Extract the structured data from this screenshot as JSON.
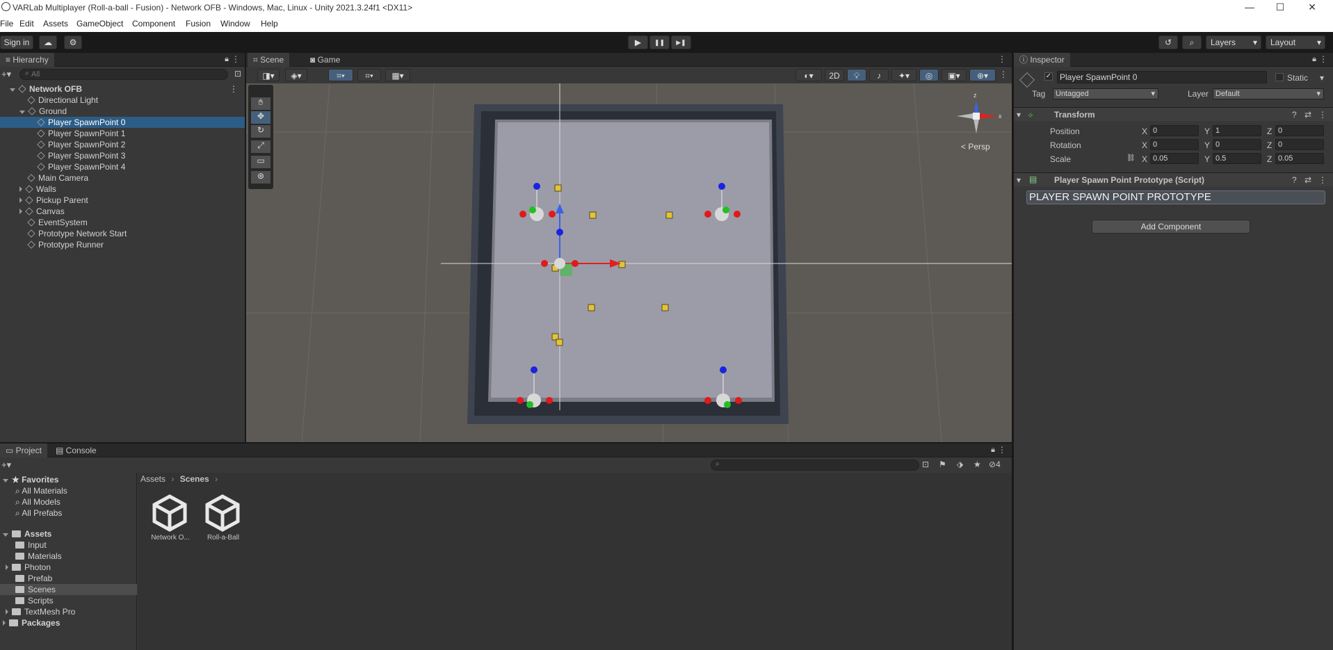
{
  "window": {
    "title": "VARLab Multiplayer (Roll-a-ball - Fusion) - Network OFB - Windows, Mac, Linux - Unity 2021.3.24f1 <DX11>",
    "minimize": "—",
    "maximize": "☐",
    "close": "✕"
  },
  "menu": [
    "File",
    "Edit",
    "Assets",
    "GameObject",
    "Component",
    "Fusion",
    "Window",
    "Help"
  ],
  "toolbar": {
    "sign_in": "Sign in",
    "cloud_icon": "cloud-icon",
    "play": "▶",
    "pause": "❚❚",
    "step": "▶❚",
    "layers": "Layers",
    "layout": "Layout"
  },
  "hierarchy": {
    "tab": "Hierarchy",
    "search_placeholder": "All",
    "items": [
      {
        "label": "Network OFB",
        "depth": 0,
        "bold": true
      },
      {
        "label": "Directional Light",
        "depth": 1
      },
      {
        "label": "Ground",
        "depth": 1
      },
      {
        "label": "Player SpawnPoint 0",
        "depth": 2,
        "selected": true
      },
      {
        "label": "Player SpawnPoint 1",
        "depth": 2
      },
      {
        "label": "Player SpawnPoint 2",
        "depth": 2
      },
      {
        "label": "Player SpawnPoint 3",
        "depth": 2
      },
      {
        "label": "Player SpawnPoint 4",
        "depth": 2
      },
      {
        "label": "Main Camera",
        "depth": 1
      },
      {
        "label": "Walls",
        "depth": 1
      },
      {
        "label": "Pickup Parent",
        "depth": 1
      },
      {
        "label": "Canvas",
        "depth": 1
      },
      {
        "label": "EventSystem",
        "depth": 1
      },
      {
        "label": "Prototype Network Start",
        "depth": 1
      },
      {
        "label": "Prototype Runner",
        "depth": 1
      }
    ]
  },
  "scene": {
    "tabs": [
      "Scene",
      "Game"
    ],
    "mode_2d": "2D",
    "persp_label": "< Persp",
    "axis_x": "x",
    "axis_z": "z"
  },
  "inspector": {
    "tab": "Inspector",
    "object_name": "Player SpawnPoint 0",
    "static_label": "Static",
    "tag_label": "Tag",
    "tag_value": "Untagged",
    "layer_label": "Layer",
    "layer_value": "Default",
    "transform_title": "Transform",
    "position_label": "Position",
    "rotation_label": "Rotation",
    "scale_label": "Scale",
    "position": {
      "x": "0",
      "y": "1",
      "z": "0"
    },
    "rotation": {
      "x": "0",
      "y": "0",
      "z": "0"
    },
    "scale": {
      "x": "0.05",
      "y": "0.5",
      "z": "0.05"
    },
    "axis": {
      "x": "X",
      "y": "Y",
      "z": "Z"
    },
    "script_title": "Player Spawn Point Prototype (Script)",
    "script_banner": "PLAYER SPAWN POINT PROTOTYPE",
    "add_component": "Add Component"
  },
  "project": {
    "tabs": [
      "Project",
      "Console"
    ],
    "favorites_label": "Favorites",
    "favorites": [
      "All Materials",
      "All Models",
      "All Prefabs"
    ],
    "assets_label": "Assets",
    "folders": [
      "Input",
      "Materials",
      "Photon",
      "Prefab",
      "Scenes",
      "Scripts",
      "TextMesh Pro"
    ],
    "packages_label": "Packages",
    "breadcrumb": [
      "Assets",
      "Scenes"
    ],
    "files": [
      "Network O...",
      "Roll-a-Ball"
    ],
    "hidden_count": "4"
  }
}
